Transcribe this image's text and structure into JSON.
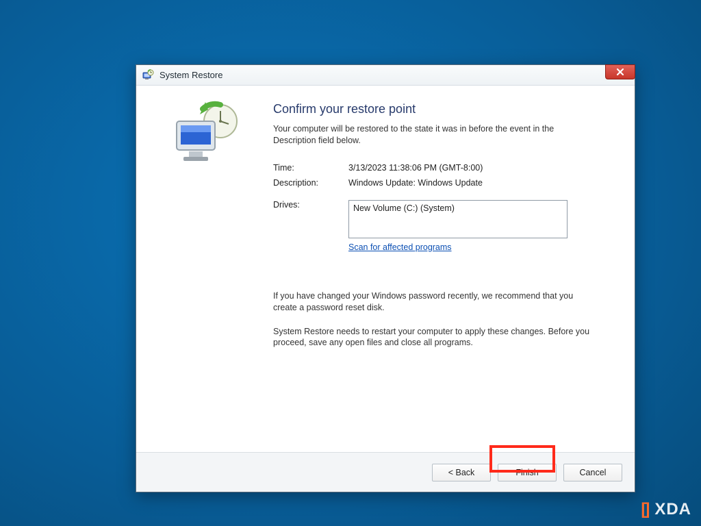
{
  "window": {
    "title": "System Restore"
  },
  "heading": "Confirm your restore point",
  "lead": "Your computer will be restored to the state it was in before the event in the Description field below.",
  "fields": {
    "time_label": "Time:",
    "time_value": "3/13/2023 11:38:06 PM (GMT-8:00)",
    "desc_label": "Description:",
    "desc_value": "Windows Update: Windows Update",
    "drives_label": "Drives:",
    "drives_value": "New Volume (C:) (System)"
  },
  "scan_link": "Scan for affected programs",
  "note1": "If you have changed your Windows password recently, we recommend that you create a password reset disk.",
  "note2": "System Restore needs to restart your computer to apply these changes. Before you proceed, save any open files and close all programs.",
  "buttons": {
    "back": "< Back",
    "finish": "Finish",
    "cancel": "Cancel"
  },
  "watermark": "XDA"
}
